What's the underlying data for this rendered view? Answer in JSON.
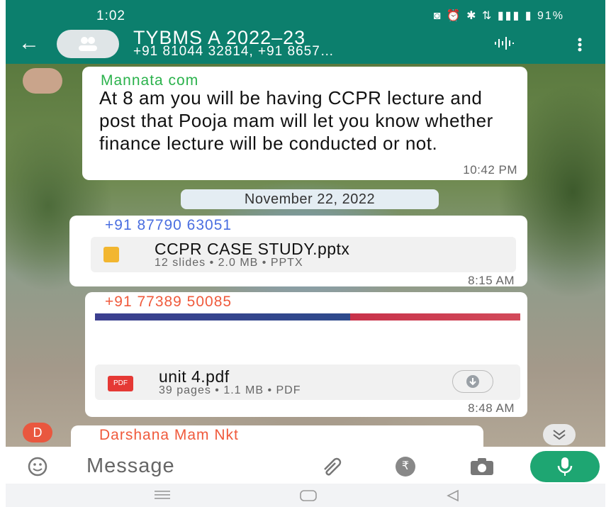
{
  "status_bar": {
    "time": "1:02",
    "icons_text": "◙ ⏰ ✱ ⇅ ▮▮▮ ▮ 91%",
    "battery": "91%"
  },
  "header": {
    "title": "TYBMS A 2022–23",
    "subtitle": "+91 81044 32814, +91 8657…",
    "icons": [
      "back-arrow-icon",
      "group-avatar-icon",
      "voice-call-icon",
      "more-options-icon"
    ]
  },
  "messages": [
    {
      "sender": "Mannata com",
      "sender_color": "#2bb24c",
      "text": "At 8 am you will be having CCPR lecture and post that Pooja mam will let you know whether finance lecture will be conducted or not.",
      "time": "10:42 PM"
    },
    {
      "sender": "+91 87790 63051",
      "sender_color": "#4a6ee0",
      "file_name": "CCPR CASE STUDY.pptx",
      "file_meta": "12 slides • 2.0 MB • PPTX",
      "time": "8:15 AM"
    },
    {
      "sender": "+91 77389 50085",
      "sender_color": "#f05a3c",
      "file_name": "unit 4.pdf",
      "file_meta": "39 pages • 1.1 MB • PDF",
      "file_badge": "PDF",
      "time": "8:48 AM"
    },
    {
      "sender": "Darshana Mam Nkt",
      "sender_color": "#f05a3c",
      "avatar_letter": "D"
    }
  ],
  "date_chip": "November 22, 2022",
  "composer": {
    "placeholder": "Message",
    "rupee_symbol": "₹"
  },
  "colors": {
    "header_bg": "#0c7f6d",
    "mic_bg": "#1ea672"
  }
}
